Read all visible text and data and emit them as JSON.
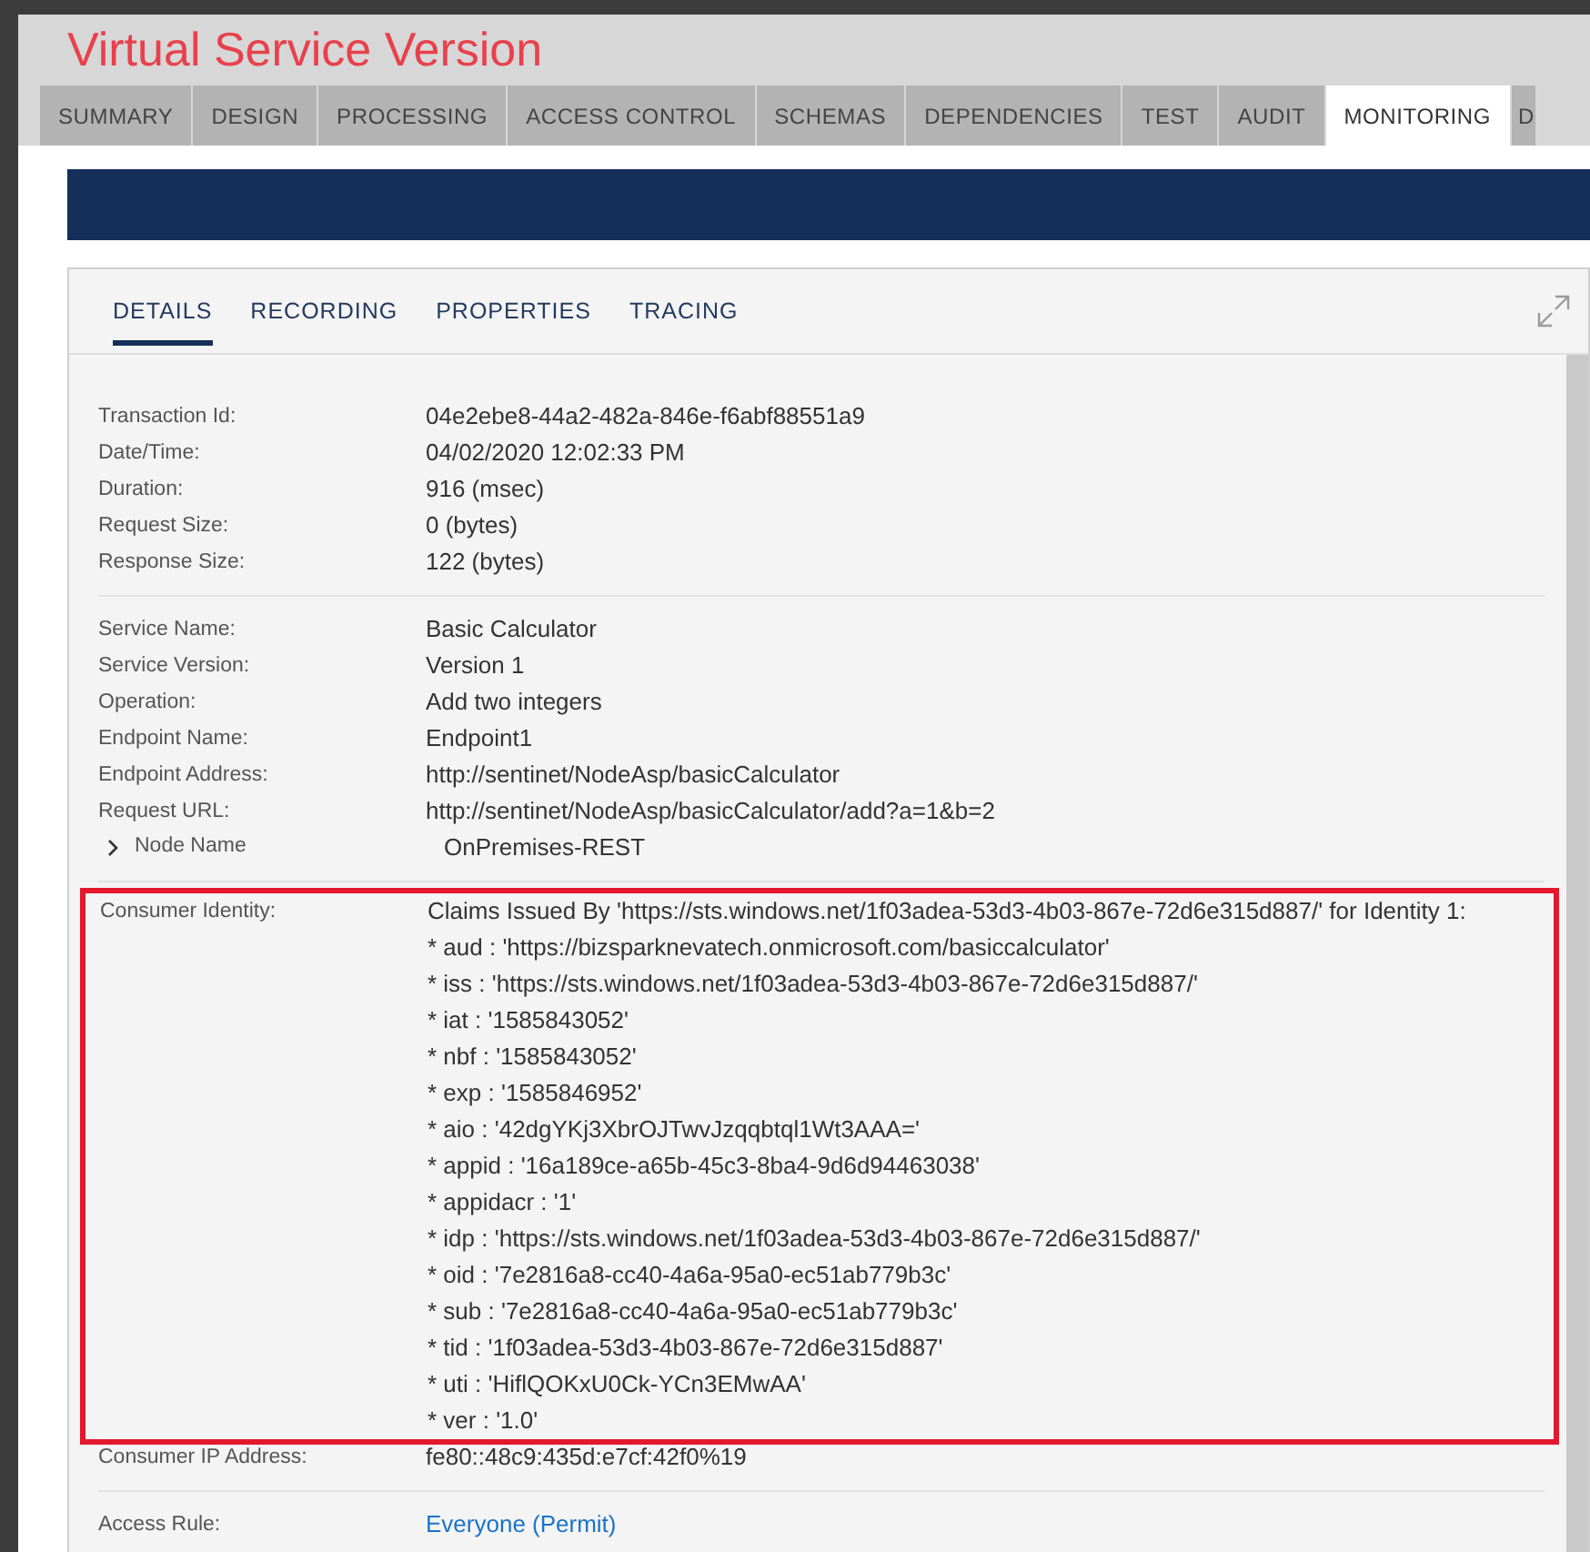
{
  "window": {
    "title": "Virtual Service Version"
  },
  "tabs": [
    {
      "label": "SUMMARY",
      "selected": false
    },
    {
      "label": "DESIGN",
      "selected": false
    },
    {
      "label": "PROCESSING",
      "selected": false
    },
    {
      "label": "ACCESS CONTROL",
      "selected": false
    },
    {
      "label": "SCHEMAS",
      "selected": false
    },
    {
      "label": "DEPENDENCIES",
      "selected": false
    },
    {
      "label": "TEST",
      "selected": false
    },
    {
      "label": "AUDIT",
      "selected": false
    },
    {
      "label": "MONITORING",
      "selected": true
    },
    {
      "label": "D",
      "selected": false
    }
  ],
  "detail_tabs": [
    {
      "label": "DETAILS",
      "selected": true
    },
    {
      "label": "RECORDING",
      "selected": false
    },
    {
      "label": "PROPERTIES",
      "selected": false
    },
    {
      "label": "TRACING",
      "selected": false
    }
  ],
  "sections": [
    {
      "fields": [
        {
          "label": "Transaction Id:",
          "value": "04e2ebe8-44a2-482a-846e-f6abf88551a9"
        },
        {
          "label": "Date/Time:",
          "value": "04/02/2020 12:02:33 PM"
        },
        {
          "label": "Duration:",
          "value": "916 (msec)"
        },
        {
          "label": "Request Size:",
          "value": "0 (bytes)"
        },
        {
          "label": "Response Size:",
          "value": "122 (bytes)"
        }
      ]
    },
    {
      "fields": [
        {
          "label": "Service Name:",
          "value": "Basic Calculator"
        },
        {
          "label": "Service Version:",
          "value": "Version 1"
        },
        {
          "label": "Operation:",
          "value": "Add two integers"
        },
        {
          "label": "Endpoint Name:",
          "value": "Endpoint1"
        },
        {
          "label": "Endpoint Address:",
          "value": "http://sentinet/NodeAsp/basicCalculator"
        },
        {
          "label": "Request URL:",
          "value": "http://sentinet/NodeAsp/basicCalculator/add?a=1&b=2"
        },
        {
          "kind": "expander",
          "expanded": false,
          "label": "Node Name",
          "value": "OnPremises-REST"
        }
      ]
    },
    {
      "fields": [
        {
          "kind": "multiline",
          "highlighted": true,
          "label": "Consumer Identity:",
          "lines": [
            "Claims Issued By 'https://sts.windows.net/1f03adea-53d3-4b03-867e-72d6e315d887/' for Identity 1:",
            "* aud : 'https://bizsparknevatech.onmicrosoft.com/basiccalculator'",
            "* iss : 'https://sts.windows.net/1f03adea-53d3-4b03-867e-72d6e315d887/'",
            "* iat : '1585843052'",
            "* nbf : '1585843052'",
            "* exp : '1585846952'",
            "* aio : '42dgYKj3XbrOJTwvJzqqbtql1Wt3AAA='",
            "* appid : '16a189ce-a65b-45c3-8ba4-9d6d94463038'",
            "* appidacr : '1'",
            "* idp : 'https://sts.windows.net/1f03adea-53d3-4b03-867e-72d6e315d887/'",
            "* oid : '7e2816a8-cc40-4a6a-95a0-ec51ab779b3c'",
            "* sub : '7e2816a8-cc40-4a6a-95a0-ec51ab779b3c'",
            "* tid : '1f03adea-53d3-4b03-867e-72d6e315d887'",
            "* uti : 'HiflQOKxU0Ck-YCn3EMwAA'",
            "* ver : '1.0'"
          ]
        },
        {
          "label": "Consumer IP Address:",
          "value": "fe80::48c9:435d:e7cf:42f0%19"
        }
      ]
    },
    {
      "fields": [
        {
          "kind": "link",
          "label": "Access Rule:",
          "value": "Everyone (Permit)"
        }
      ]
    }
  ]
}
